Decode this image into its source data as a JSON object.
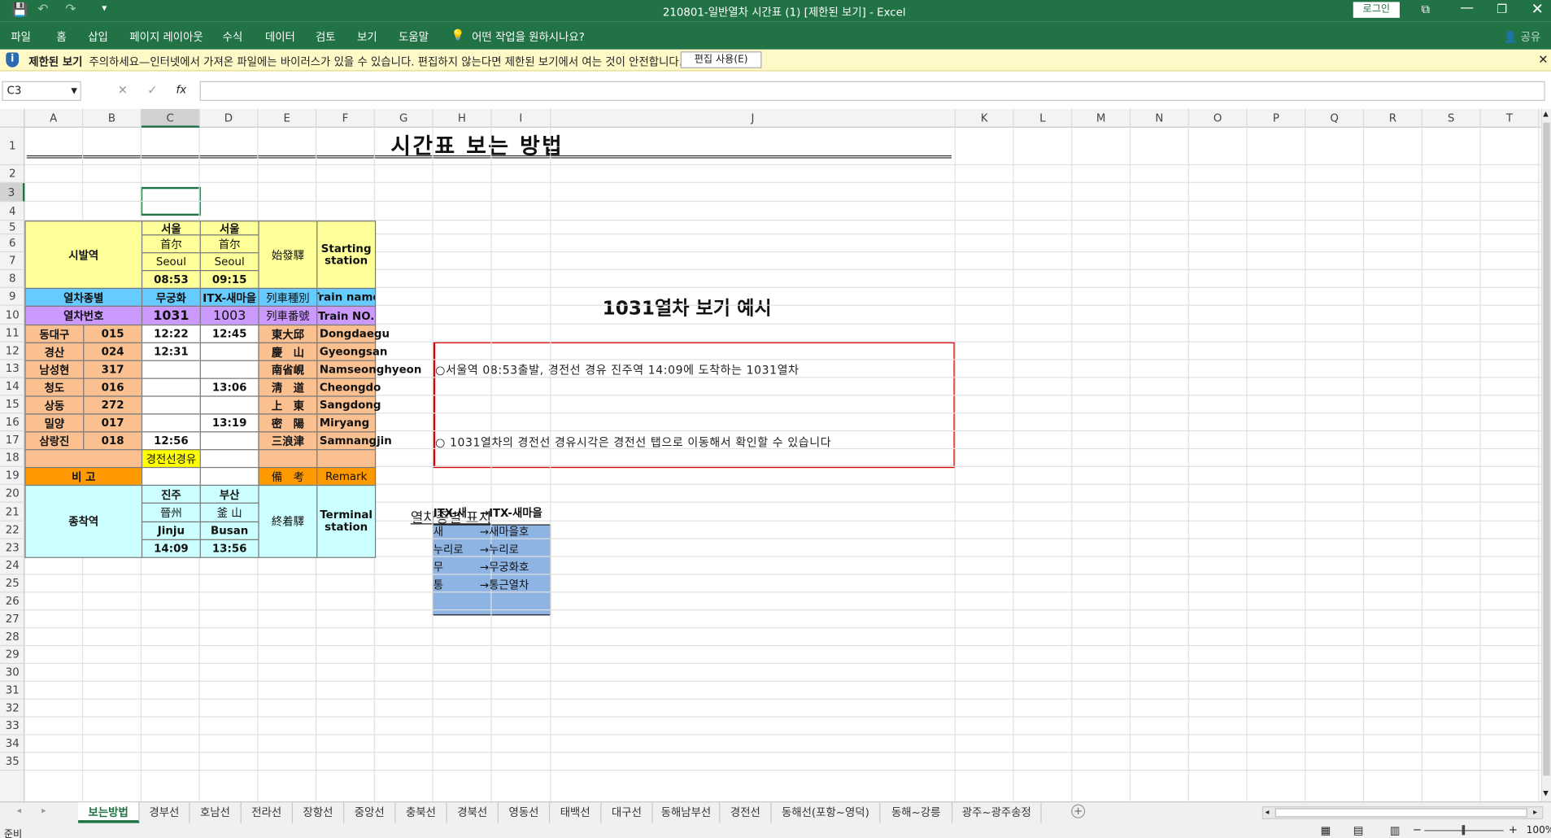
{
  "titlebar": {
    "title": "210801-일반열차 시간표 (1)  [제한된 보기]  -  Excel",
    "login": "로그인",
    "share": "공유"
  },
  "menu": [
    "파일",
    "홈",
    "삽입",
    "페이지 레이아웃",
    "수식",
    "데이터",
    "검토",
    "보기",
    "도움말"
  ],
  "tellme": "어떤 작업을 원하시나요?",
  "msgbar": {
    "label": "제한된 보기",
    "text": "주의하세요—인터넷에서 가져온 파일에는 바이러스가 있을 수 있습니다. 편집하지 않는다면 제한된 보기에서 여는 것이 안전합니다.",
    "button": "편집 사용(E)"
  },
  "formula": {
    "namebox": "C3",
    "fx": "fx",
    "value": ""
  },
  "columns": [
    "A",
    "B",
    "C",
    "D",
    "E",
    "F",
    "G",
    "H",
    "I",
    "J",
    "K",
    "L",
    "M",
    "N",
    "O",
    "P",
    "Q",
    "R",
    "S",
    "T"
  ],
  "rows": [
    "1",
    "2",
    "3",
    "4",
    "5",
    "6",
    "7",
    "8",
    "9",
    "10",
    "11",
    "12",
    "13",
    "14",
    "15",
    "16",
    "17",
    "18",
    "19",
    "20",
    "21",
    "22",
    "23",
    "24",
    "25",
    "26",
    "27",
    "28",
    "29",
    "30",
    "31",
    "32",
    "33",
    "34",
    "35"
  ],
  "sheet": {
    "title": "시간표 보는 방법",
    "origin": {
      "label": "시발역",
      "c1": [
        "서울",
        "首尔",
        "Seoul",
        "08:53"
      ],
      "c2": [
        "서울",
        "首尔",
        "Seoul",
        "09:15"
      ],
      "hanja": "始發驛",
      "eng": "Starting station"
    },
    "type_row": {
      "label": "열차종별",
      "c1": "무궁화",
      "c2": "ITX-새마을",
      "hanja": "列車種別",
      "eng": "Train name"
    },
    "num_row": {
      "label": "열차번호",
      "c1": "1031",
      "c2": "1003",
      "hanja": "列車番號",
      "eng": "Train NO."
    },
    "stations": [
      {
        "name": "동대구",
        "code": "015",
        "c1": "12:22",
        "c2": "12:45",
        "hanja": "東大邱",
        "eng": "Dongdaegu"
      },
      {
        "name": "경산",
        "code": "024",
        "c1": "12:31",
        "c2": "",
        "hanja": "慶　山",
        "eng": "Gyeongsan"
      },
      {
        "name": "남성현",
        "code": "317",
        "c1": "",
        "c2": "",
        "hanja": "南省峴",
        "eng": "Namseonghyeon"
      },
      {
        "name": "청도",
        "code": "016",
        "c1": "",
        "c2": "13:06",
        "hanja": "淸　道",
        "eng": "Cheongdo"
      },
      {
        "name": "상동",
        "code": "272",
        "c1": "",
        "c2": "",
        "hanja": "上　東",
        "eng": "Sangdong"
      },
      {
        "name": "밀양",
        "code": "017",
        "c1": "",
        "c2": "13:19",
        "hanja": "密　陽",
        "eng": "Miryang"
      },
      {
        "name": "삼랑진",
        "code": "018",
        "c1": "12:56",
        "c2": "",
        "hanja": "三浪津",
        "eng": "Samnangjin"
      }
    ],
    "via": "경전선경유",
    "remark": {
      "label": "비  고",
      "hanja": "備　考",
      "eng": "Remark"
    },
    "dest": {
      "label": "종착역",
      "c1": [
        "진주",
        "晉州",
        "Jinju",
        "14:09"
      ],
      "c2": [
        "부산",
        "釜 山",
        "Busan",
        "13:56"
      ],
      "hanja": "終着驛",
      "eng": "Terminal station"
    },
    "example": {
      "title": "1031열차 보기 예시",
      "line1": "○서울역 08:53출발, 경전선 경유 진주역 14:09에 도착하는 1031열차",
      "line2": "○ 1031열차의 경전선 경유시각은 경전선 탭으로 이동해서 확인할 수 있습니다"
    },
    "legend": {
      "title": "열차종별 표시",
      "items": [
        [
          "ITX-새",
          "→ITX-새마을"
        ],
        [
          "새",
          "→새마을호"
        ],
        [
          "누리로",
          "→누리로"
        ],
        [
          "무",
          "→무궁화호"
        ],
        [
          "통",
          "→통근열차"
        ]
      ]
    }
  },
  "tabs": [
    "보는방법",
    "경부선",
    "호남선",
    "전라선",
    "장항선",
    "중앙선",
    "충북선",
    "경북선",
    "영동선",
    "태백선",
    "대구선",
    "동해남부선",
    "경전선",
    "동해선(포항~영덕)",
    "동해~강릉",
    "광주~광주송정"
  ],
  "status": {
    "ready": "준비",
    "zoom": "100%"
  },
  "colors": {
    "accent": "#217346",
    "yellow": "#ffff99",
    "blue": "#66ccff",
    "purple": "#cc99ff",
    "orange": "#fac090",
    "remark": "#ff9900",
    "cyan": "#ccffff",
    "via": "#ffff00",
    "legend": "#8db4e2",
    "red": "#e00000"
  }
}
